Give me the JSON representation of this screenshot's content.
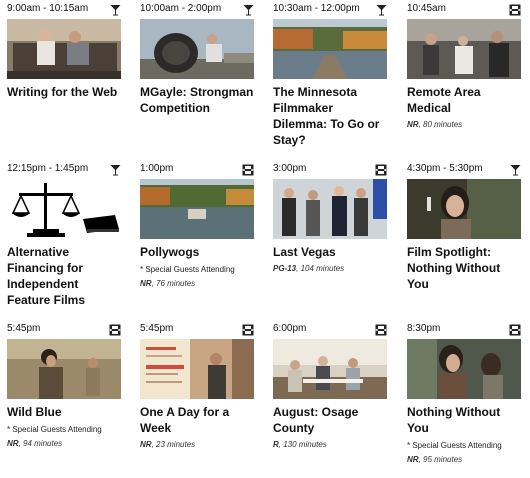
{
  "events": [
    {
      "time": "9:00am - 10:15am",
      "icon": "martini-glass-icon",
      "title": "Writing for the Web",
      "guests": "",
      "rating": "",
      "duration": ""
    },
    {
      "time": "10:00am - 2:00pm",
      "icon": "martini-glass-icon",
      "title": "MGayle: Strongman Competition",
      "guests": "",
      "rating": "",
      "duration": ""
    },
    {
      "time": "10:30am - 12:00pm",
      "icon": "martini-glass-icon",
      "title": "The Minnesota Filmmaker Dilemma: To Go or Stay?",
      "guests": "",
      "rating": "",
      "duration": ""
    },
    {
      "time": "10:45am",
      "icon": "film-strip-icon",
      "title": "Remote Area Medical",
      "guests": "",
      "rating": "NR",
      "duration": ", 80 minutes"
    },
    {
      "time": "12:15pm - 1:45pm",
      "icon": "martini-glass-icon",
      "title": "Alternative Financing for Independent Feature Films",
      "guests": "",
      "rating": "",
      "duration": ""
    },
    {
      "time": "1:00pm",
      "icon": "film-strip-icon",
      "title": "Pollywogs",
      "guests": "* Special Guests Attending",
      "rating": "NR",
      "duration": ", 76 minutes"
    },
    {
      "time": "3:00pm",
      "icon": "film-strip-icon",
      "title": "Last Vegas",
      "guests": "",
      "rating": "PG-13",
      "duration": ", 104 minutes"
    },
    {
      "time": "4:30pm - 5:30pm",
      "icon": "martini-glass-icon",
      "title": "Film Spotlight: Nothing Without You",
      "guests": "",
      "rating": "",
      "duration": ""
    },
    {
      "time": "5:45pm",
      "icon": "film-strip-icon",
      "title": "Wild Blue",
      "guests": "* Special Guests Attending",
      "rating": "NR",
      "duration": ", 94 minutes"
    },
    {
      "time": "5:45pm",
      "icon": "film-strip-icon",
      "title": "One A Day for a Week",
      "guests": "",
      "rating": "NR",
      "duration": ", 23 minutes"
    },
    {
      "time": "6:00pm",
      "icon": "film-strip-icon",
      "title": "August: Osage County",
      "guests": "",
      "rating": "R",
      "duration": ", 130 minutes"
    },
    {
      "time": "8:30pm",
      "icon": "film-strip-icon",
      "title": "Nothing Without You",
      "guests": "* Special Guests Attending",
      "rating": "NR",
      "duration": ", 95 minutes"
    }
  ]
}
